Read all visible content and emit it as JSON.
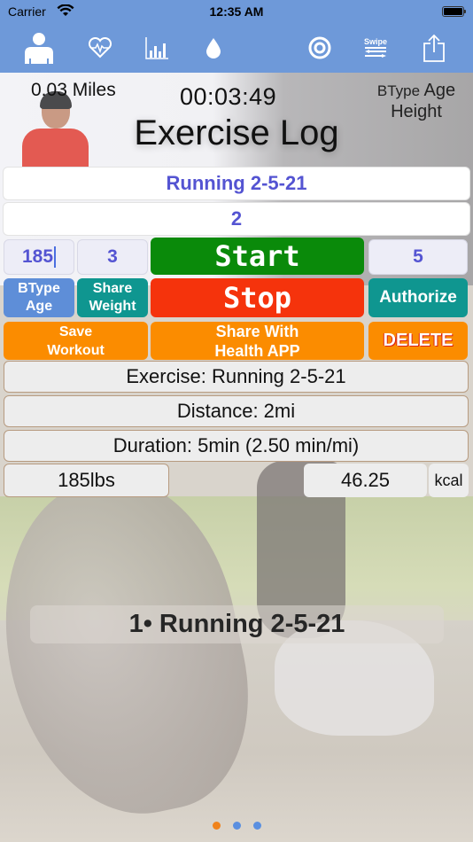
{
  "status_bar": {
    "carrier": "Carrier",
    "time": "12:35 AM"
  },
  "toolbar": {
    "icons": [
      "person-icon",
      "heart-rate-icon",
      "bar-chart-icon",
      "water-drop-icon",
      "target-icon",
      "swipe-icon",
      "share-icon"
    ],
    "swipe_label": "Swipe"
  },
  "header": {
    "distance": "0.03 Miles",
    "timer": "00:03:49",
    "btype_label": "BType",
    "age_label": "Age",
    "height_label": "Height",
    "title": "Exercise Log"
  },
  "form": {
    "exercise_name": "Running 2-5-21",
    "distance_value": "2",
    "weight_value": "185",
    "multiplier_value": "3",
    "minutes_value": "5"
  },
  "buttons": {
    "start": "Start",
    "stop": "Stop",
    "btype_line1": "BType",
    "btype_line2": "Age",
    "share_weight_line1": "Share",
    "share_weight_line2": "Weight",
    "authorize": "Authorize",
    "save_line1": "Save",
    "save_line2": "Workout",
    "share_health_line1": "Share With",
    "share_health_line2": "Health APP",
    "delete": "DELETE"
  },
  "summary": {
    "exercise": "Exercise: Running 2-5-21",
    "distance": "Distance: 2mi",
    "duration": "Duration: 5min (2.50 min/mi)",
    "weight": "185lbs",
    "calories": "46.25",
    "calories_unit": "kcal"
  },
  "log_list": {
    "items": [
      "1• Running 2-5-21"
    ]
  },
  "page_indicator": {
    "total": 3,
    "current": 1
  },
  "colors": {
    "toolbar_bg": "#6e99d9",
    "start": "#0a8a0a",
    "stop": "#f5330c",
    "teal": "#0f9690",
    "blue_button": "#5e8ed8",
    "orange": "#fb8c00",
    "input_text": "#5454d2",
    "dot_active": "#f0831c",
    "dot_inactive": "#5a8fe0"
  }
}
